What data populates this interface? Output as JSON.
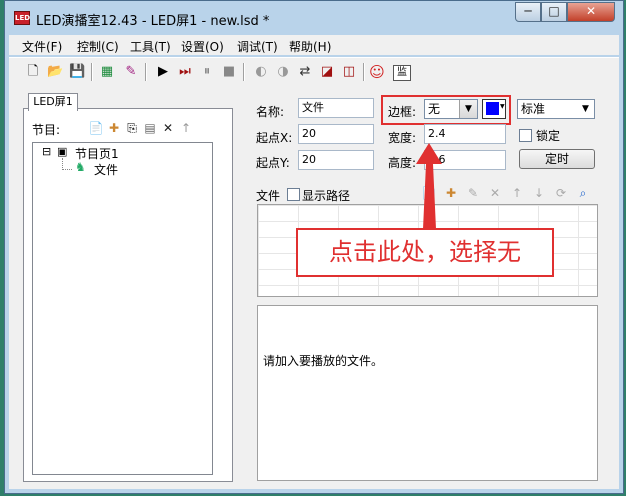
{
  "window": {
    "title": "LED演播室12.43 - LED屏1 - new.lsd *",
    "app_icon_text": "LED"
  },
  "window_controls": {
    "minimize": "─",
    "maximize": "□",
    "close": "✕"
  },
  "menu": [
    {
      "label": "文件(F)"
    },
    {
      "label": "控制(C)"
    },
    {
      "label": "工具(T)"
    },
    {
      "label": "设置(O)"
    },
    {
      "label": "调试(T)"
    },
    {
      "label": "帮助(H)"
    }
  ],
  "toolbar_icons": {
    "new": "🗋",
    "open": "📂",
    "save": "💾",
    "grid": "▦",
    "edit": "✎",
    "play": "▶",
    "step": "⏭",
    "pause": "⏸",
    "stop": "■",
    "b1": "◐",
    "b2": "◑",
    "b3": "⇄",
    "b4": "◪",
    "b5": "◫",
    "smile": "☺",
    "monitor": "监"
  },
  "left": {
    "tab": "LED屏1",
    "program_label": "节目:",
    "tree": {
      "root_toggle": "⊟",
      "root": "节目页1",
      "child": "文件"
    }
  },
  "props": {
    "name_label": "名称:",
    "name_value": "文件",
    "x_label": "起点X:",
    "x_value": "20",
    "y_label": "起点Y:",
    "y_value": "20",
    "border_label": "边框:",
    "border_value": "无",
    "width_label": "宽度:",
    "width_value": "2.4",
    "height_label": "高度:",
    "height_value": "1.6",
    "style_value": "标准",
    "lock_label": "锁定",
    "timer_button": "定时",
    "border_color": "#0000ff"
  },
  "files": {
    "label": "文件",
    "show_path_label": "显示路径",
    "hint": "请加入要播放的文件。"
  },
  "annotation": {
    "text": "点击此处，选择无",
    "color": "#e03030"
  }
}
